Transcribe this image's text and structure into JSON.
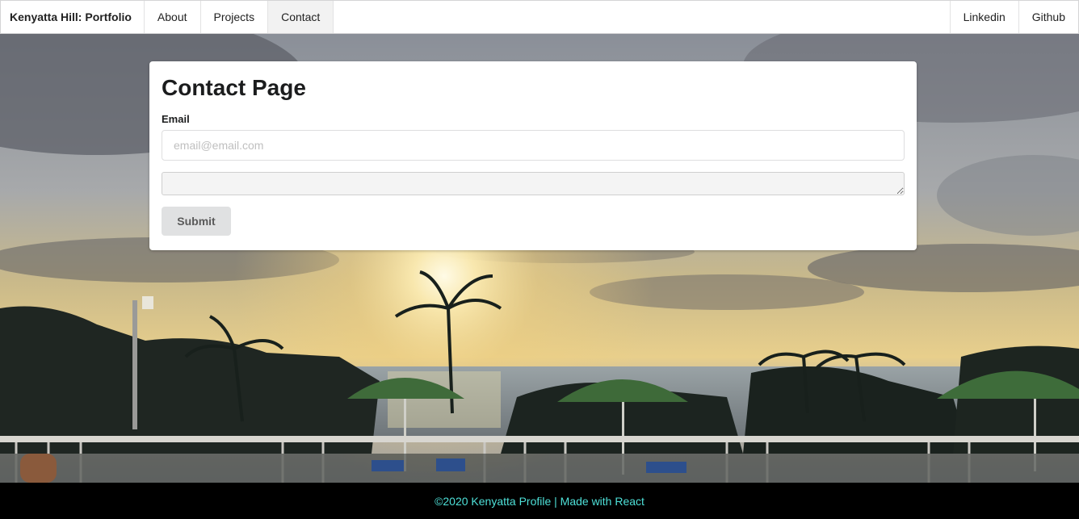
{
  "nav": {
    "brand": "Kenyatta Hill: Portfolio",
    "items": [
      {
        "label": "About"
      },
      {
        "label": "Projects"
      },
      {
        "label": "Contact",
        "active": true
      }
    ],
    "right_items": [
      {
        "label": "Linkedin"
      },
      {
        "label": "Github"
      }
    ]
  },
  "form": {
    "title": "Contact Page",
    "email_label": "Email",
    "email_placeholder": "email@email.com",
    "email_value": "",
    "message_value": "",
    "submit_label": "Submit"
  },
  "footer": {
    "text": "©2020 Kenyatta Profile | Made with React",
    "color": "#4ee0d8"
  },
  "background": {
    "description_icon": "sunset-beach-photo"
  }
}
